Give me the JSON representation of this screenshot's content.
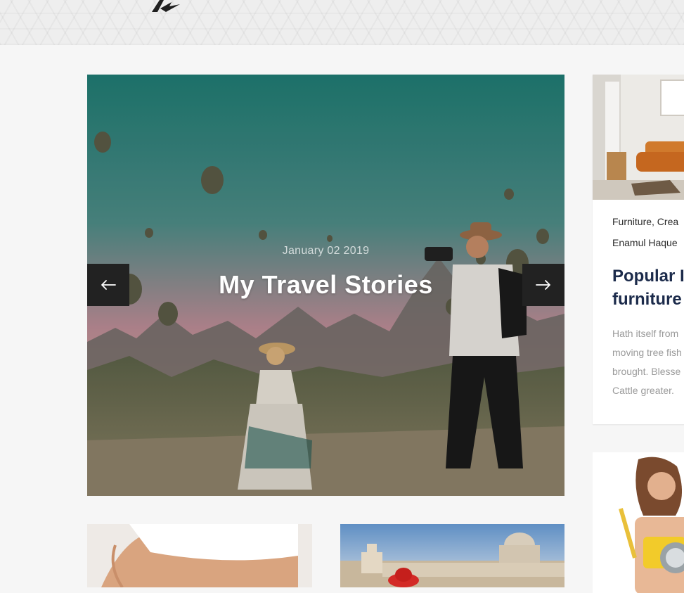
{
  "colors": {
    "page_bg": "#f6f6f6",
    "arrow_bg": "#222222",
    "title_navy": "#1c2b4b",
    "excerpt_gray": "#9a9a9a"
  },
  "icons": {
    "logo": "brand-logo",
    "prev": "arrow-left-icon",
    "next": "arrow-right-icon"
  },
  "hero": {
    "date": "January 02 2019",
    "title": "My Travel Stories"
  },
  "sidebar_post": {
    "categories": "Furniture, Crea",
    "author": "Enamul Haque",
    "title_lines": [
      "Popular I",
      "furniture"
    ],
    "excerpt_lines": [
      "Hath itself from",
      "moving tree fish",
      "brought. Blesse",
      "Cattle greater."
    ]
  }
}
